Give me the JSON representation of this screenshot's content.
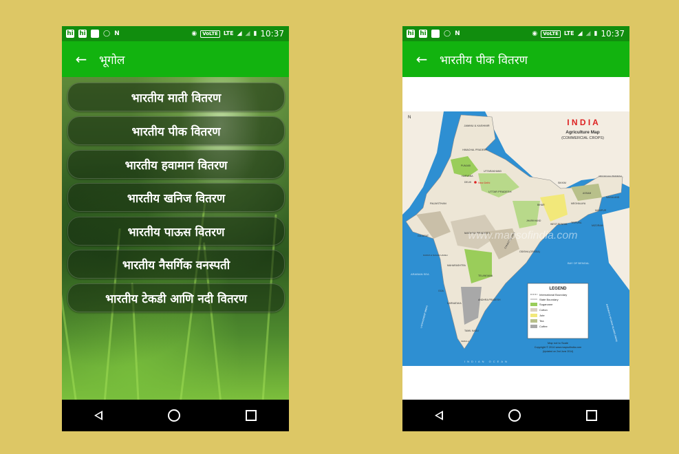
{
  "left": {
    "status": {
      "icons": [
        "hi",
        "hi",
        "image",
        "whatsapp",
        "N"
      ],
      "right_icons": [
        "hotspot",
        "VoLTE",
        "LTE",
        "signal",
        "battery"
      ],
      "time": "10:37"
    },
    "title": "भूगोल",
    "menu": [
      "भारतीय माती वितरण",
      "भारतीय पीक वितरण",
      "भारतीय हवामान वितरण",
      "भारतीय खनिज वितरण",
      "भारतीय पाऊस वितरण",
      "भारतीय नैसर्गिक वनस्पती",
      "भारतीय टेकडी आणि नदी वितरण"
    ]
  },
  "right": {
    "status": {
      "time": "10:37"
    },
    "title": "भारतीय पीक वितरण",
    "map": {
      "heading": "I N D I A",
      "subtitle1": "Agriculture Map",
      "subtitle2": "(COMMERCIAL CROPS)",
      "watermark": "www.mapsofindia.com",
      "states": [
        "JAMMU & KASHMIR",
        "HIMACHAL PRADESH",
        "PUNJAB",
        "UTTARAKHAND",
        "HARYANA",
        "DELHI",
        "New Delhi",
        "UTTAR PRADESH",
        "RAJASTHAN",
        "SIKKIM",
        "ARUNACHAL PRADESH",
        "ASSAM",
        "NAGALAND",
        "MEGHALAYA",
        "MANIPUR",
        "BIHAR",
        "JHARKHAND",
        "WEST BENGAL",
        "TRIPURA",
        "MIZORAM",
        "MADHYA PRADESH",
        "GUJARAT",
        "CHHATTISGARH",
        "ODISHA (ORISSA)",
        "DADRA & NAGAR HAVELI",
        "MAHARASHTRA",
        "TELANGANA",
        "ANDHRA PRADESH",
        "KARNATAKA",
        "GOA",
        "TAMIL NADU",
        "KERALA",
        "LAKSHADWEEP (INDIA)",
        "ANDAMAN & NICOBAR ISLANDS (INDIA)"
      ],
      "seas": [
        "ARABIAN SEA",
        "BAY OF BENGAL",
        "INDIAN OCEAN"
      ],
      "legend": {
        "title": "LEGEND",
        "items": [
          {
            "label": "International Boundary",
            "color": "line-dashed"
          },
          {
            "label": "State Boundary",
            "color": "line"
          },
          {
            "label": "Sugarcane",
            "color": "#9ACD5A"
          },
          {
            "label": "Cotton",
            "color": "#D9CFC0"
          },
          {
            "label": "Jute",
            "color": "#F2E87A"
          },
          {
            "label": "Tea",
            "color": "#B8C08A"
          },
          {
            "label": "Coffee",
            "color": "#A8A8A8"
          }
        ]
      },
      "scale": "Map not to Scale",
      "copyright": "Copyright © 2014  www.mapsofindia.com",
      "updated": "(Updated on 2nd June 2014)",
      "north": "N"
    }
  },
  "colors": {
    "statusbar": "#118D0E",
    "appbar": "#12B30F",
    "background": "#DDC765"
  }
}
